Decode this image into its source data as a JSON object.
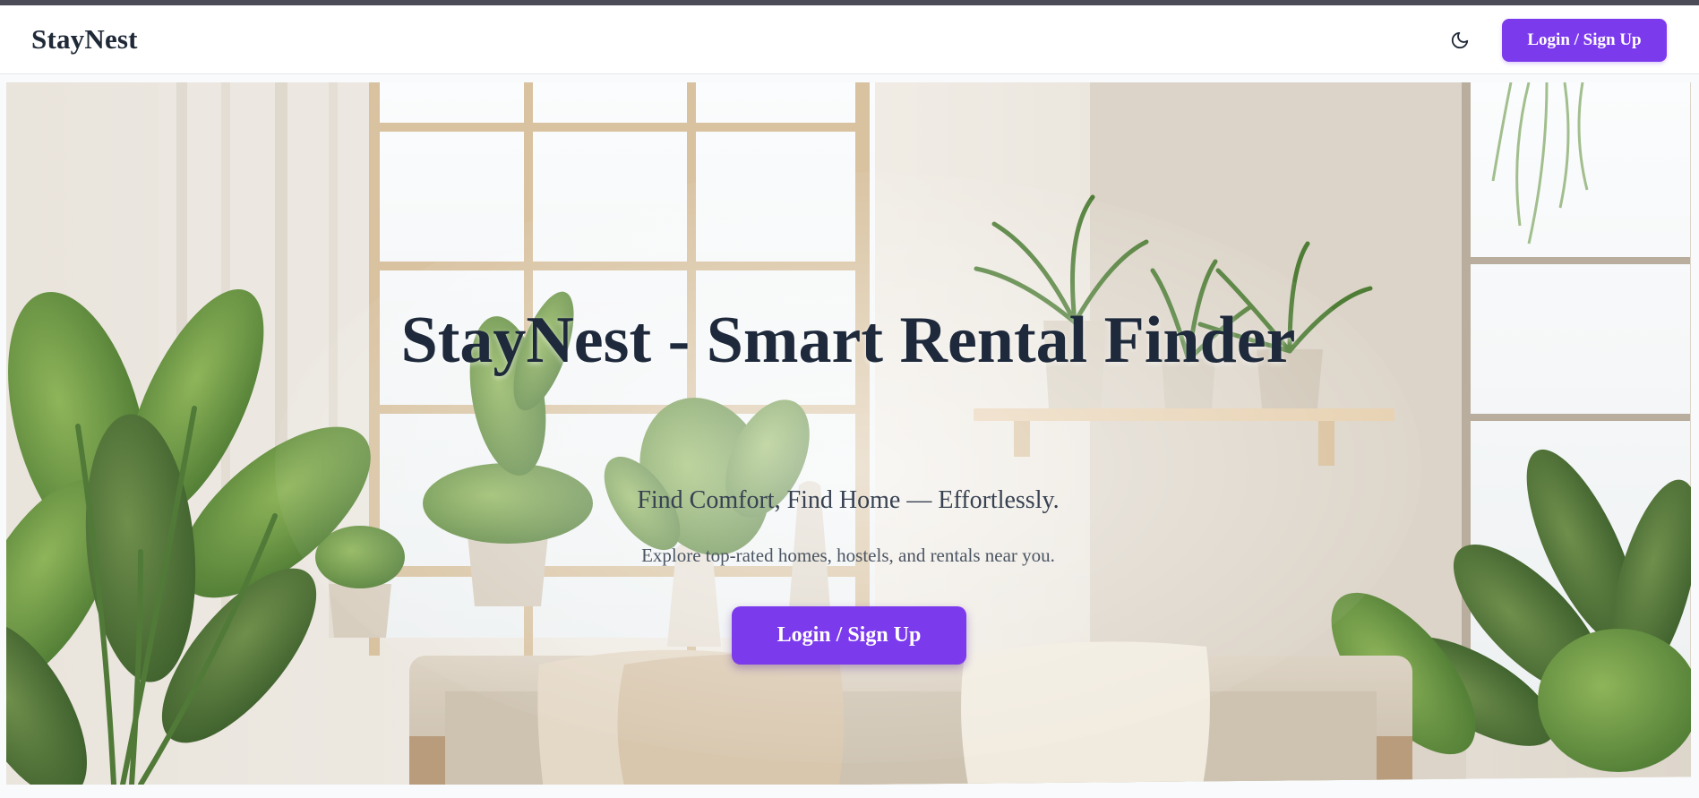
{
  "navbar": {
    "brand": "StayNest",
    "theme_toggle_icon": "moon-icon",
    "login_label": "Login / Sign Up"
  },
  "hero": {
    "title": "StayNest - Smart Rental Finder",
    "tagline": "Find Comfort, Find Home — Effortlessly.",
    "subtitle": "Explore top-rated homes, hostels, and rentals near you.",
    "login_label": "Login / Sign Up",
    "background_image": "living-room-with-plants"
  },
  "colors": {
    "accent": "#7c3aed",
    "heading": "#1e293b",
    "text": "#374151",
    "nav_bg": "#ffffff",
    "page_bg": "#f8fafc"
  }
}
